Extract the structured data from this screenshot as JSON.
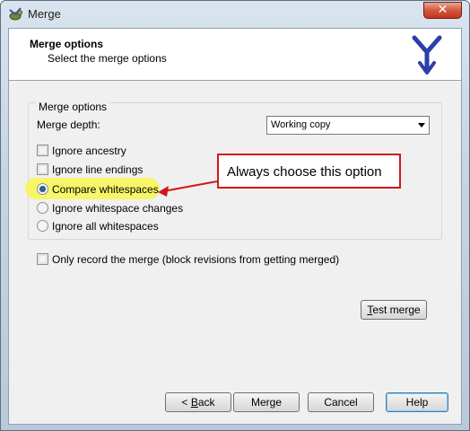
{
  "window": {
    "title": "Merge",
    "close_glyph": "✕"
  },
  "header": {
    "title": "Merge options",
    "subtitle": "Select the merge options"
  },
  "group": {
    "legend": "Merge options",
    "depth_label": "Merge depth:",
    "depth_value": "Working copy",
    "checkboxes": [
      {
        "label": "Ignore ancestry",
        "checked": false
      },
      {
        "label": "Ignore line endings",
        "checked": false
      }
    ],
    "radios": [
      {
        "label": "Compare whitespaces",
        "checked": true
      },
      {
        "label": "Ignore whitespace changes",
        "checked": false
      },
      {
        "label": "Ignore all whitespaces",
        "checked": false
      }
    ]
  },
  "record_only": {
    "label": "Only record the merge (block revisions from getting merged)",
    "checked": false
  },
  "annotation": {
    "text": "Always choose this option",
    "color": "#d01818",
    "highlight_color": "#f7f55a"
  },
  "buttons": {
    "test_merge": {
      "u": "T",
      "rest": "est merge"
    },
    "back": {
      "pre": "< ",
      "u": "B",
      "rest": "ack"
    },
    "merge": "Merge",
    "cancel": "Cancel",
    "help": "Help"
  },
  "icons": {
    "app": "tortoise-merge-icon",
    "logo": "merge-branch-logo-icon"
  }
}
